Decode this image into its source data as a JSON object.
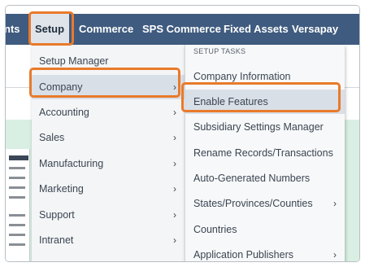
{
  "nav": {
    "items": [
      {
        "label": "nts"
      },
      {
        "label": "Setup"
      },
      {
        "label": "Commerce"
      },
      {
        "label": "SPS Commerce"
      },
      {
        "label": "Fixed Assets"
      },
      {
        "label": "Versapay"
      }
    ]
  },
  "menu1": {
    "items": [
      {
        "label": "Setup Manager"
      },
      {
        "label": "Company"
      },
      {
        "label": "Accounting"
      },
      {
        "label": "Sales"
      },
      {
        "label": "Manufacturing"
      },
      {
        "label": "Marketing"
      },
      {
        "label": "Support"
      },
      {
        "label": "Intranet"
      }
    ]
  },
  "menu2": {
    "header": "SETUP TASKS",
    "items": [
      {
        "label": "Company Information"
      },
      {
        "label": "Enable Features"
      },
      {
        "label": "Subsidiary Settings Manager"
      },
      {
        "label": "Rename Records/Transactions"
      },
      {
        "label": "Auto-Generated Numbers"
      },
      {
        "label": "States/Provinces/Counties"
      },
      {
        "label": "Countries"
      },
      {
        "label": "Application Publishers"
      }
    ]
  },
  "icons": {
    "chevron": "›"
  },
  "colors": {
    "nav_bg": "#3f5b7f",
    "highlight": "#e97a2b",
    "selected_bg": "#d9dfe7"
  }
}
